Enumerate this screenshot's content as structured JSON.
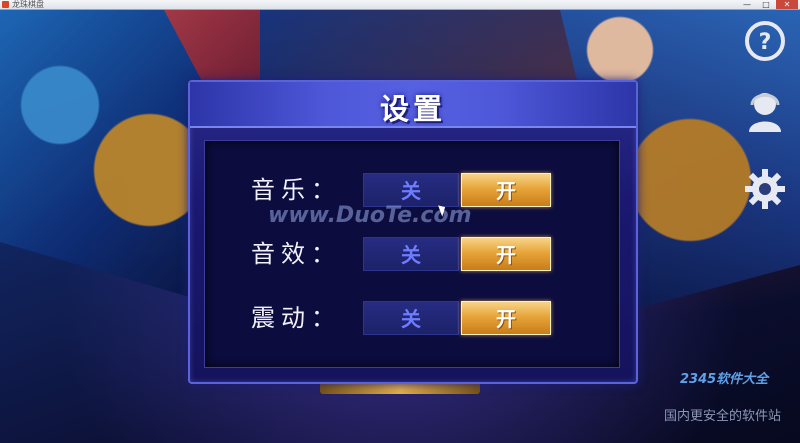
{
  "window": {
    "title": "龙珠棋盘",
    "min_label": "—",
    "max_label": "□",
    "close_label": "✕"
  },
  "dialog": {
    "title": "设置",
    "rows": [
      {
        "label": "音乐：",
        "off_label": "关",
        "on_label": "开",
        "selected": "on"
      },
      {
        "label": "音效：",
        "off_label": "关",
        "on_label": "开",
        "selected": "on"
      },
      {
        "label": "震动：",
        "off_label": "关",
        "on_label": "开",
        "selected": "on"
      }
    ]
  },
  "side_icons": [
    "help-icon",
    "user-icon",
    "gear-icon"
  ],
  "watermark": "www.DuoTe.com",
  "corner_logo": {
    "brand": "2345软件大全",
    "tagline": "国内更安全的软件站"
  },
  "colors": {
    "dialog_bg": "#1a1870",
    "header_bg": "#4d57d8",
    "on_button": "#e7a53a",
    "off_text": "#6e7cff"
  }
}
